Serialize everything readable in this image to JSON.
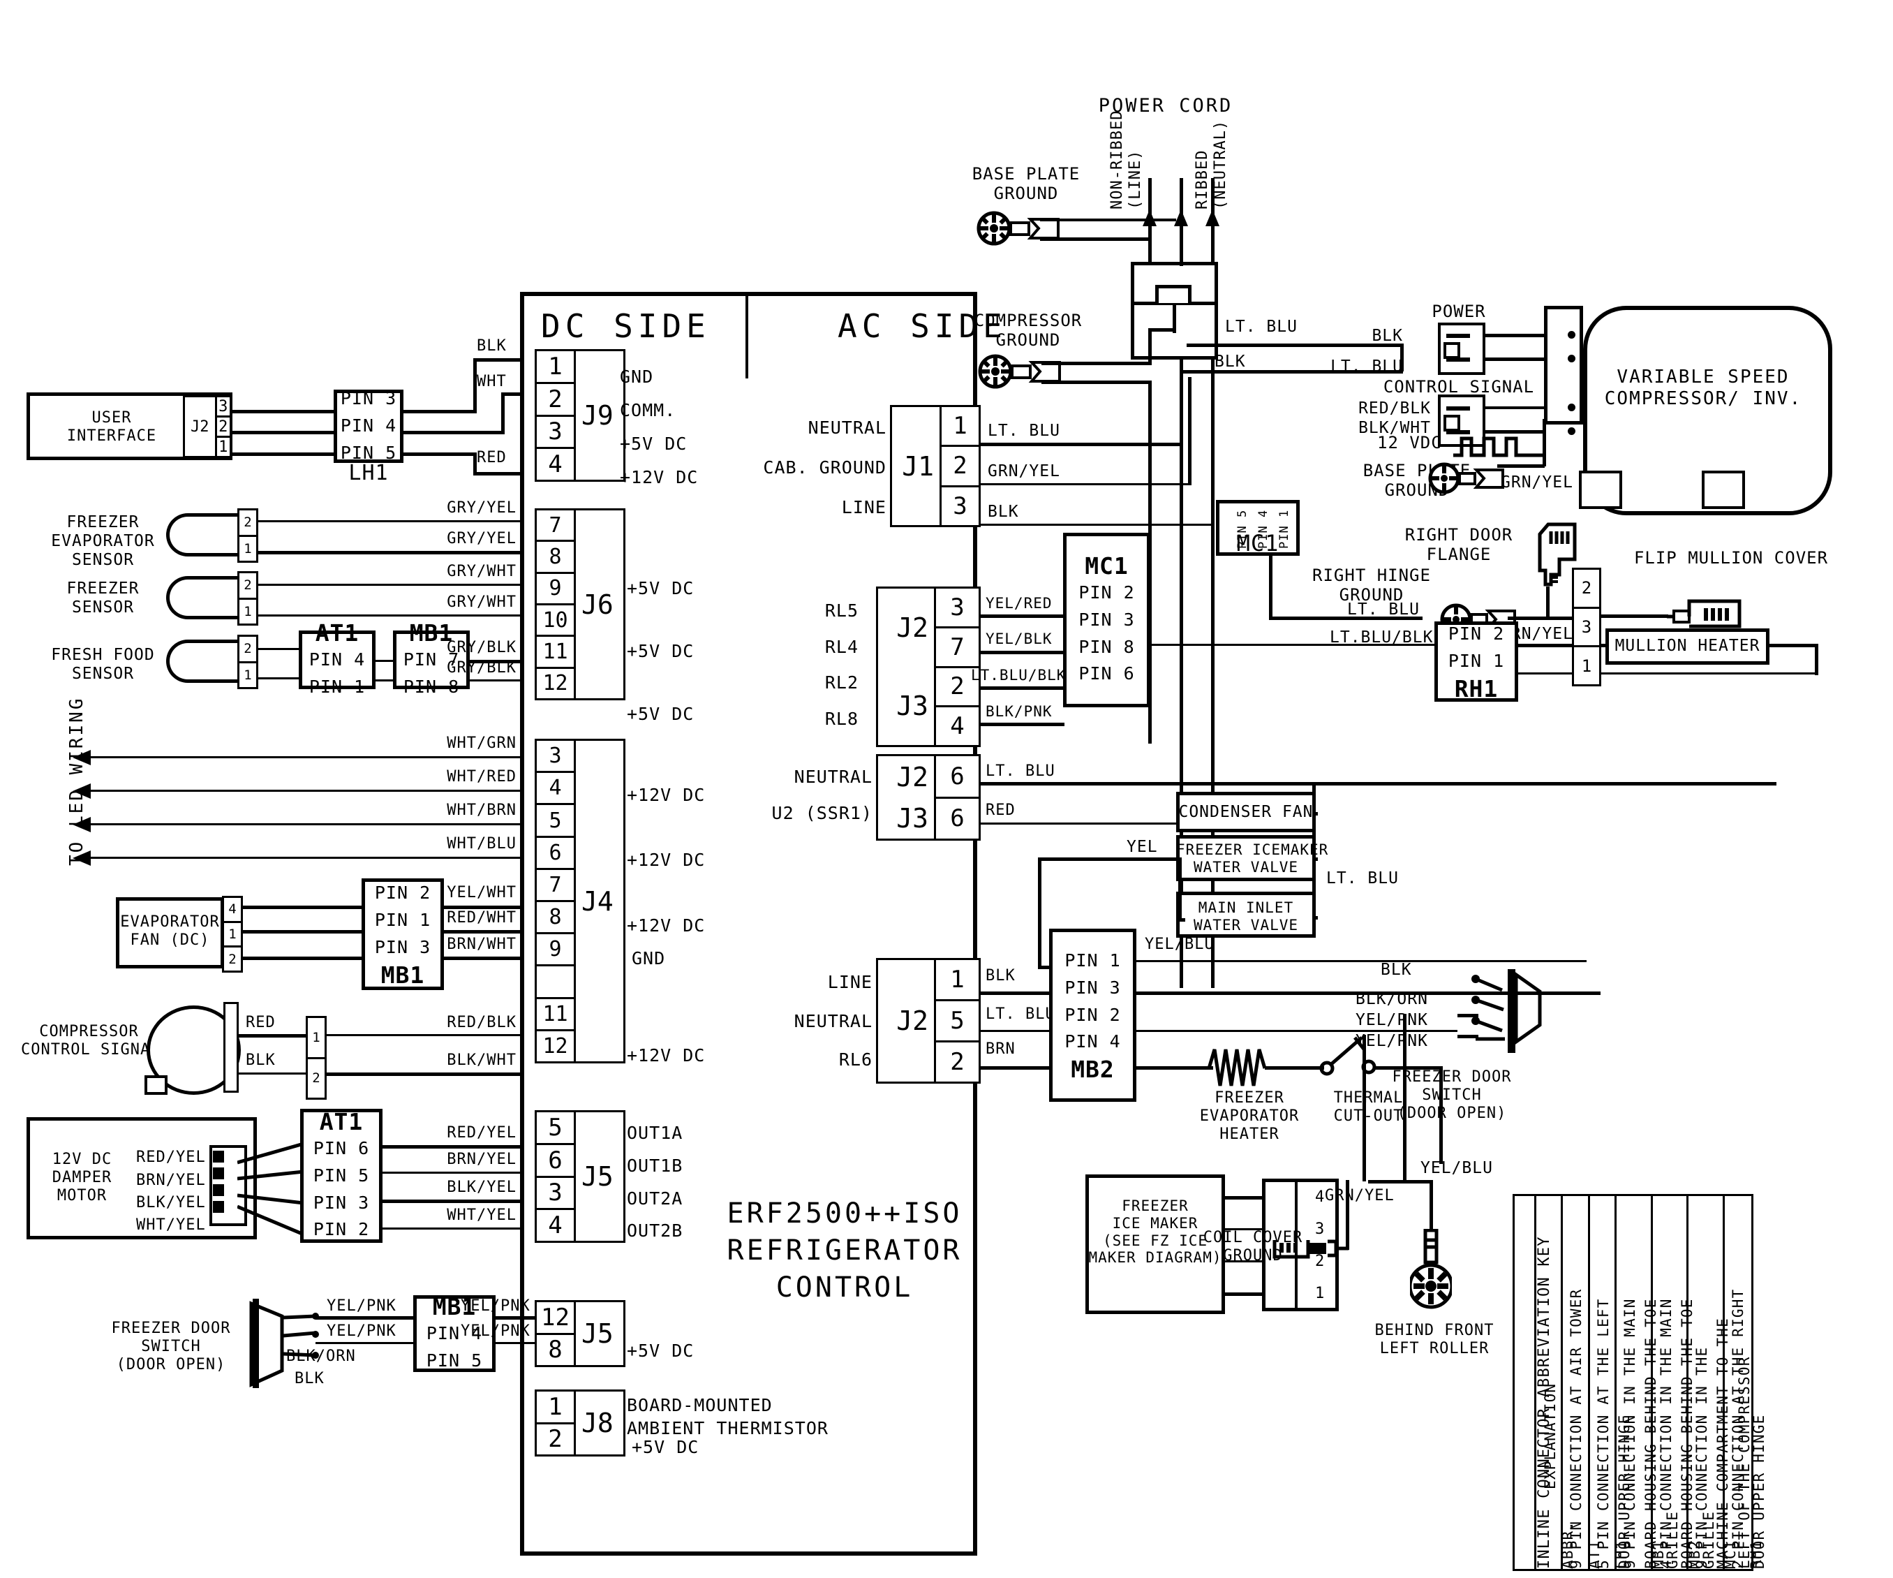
{
  "board": {
    "dc_side": "DC SIDE",
    "ac_side": "AC SIDE",
    "title_line1": "ERF2500++ISO",
    "title_line2": "REFRIGERATOR",
    "title_line3": "CONTROL"
  },
  "connectors": {
    "j9": {
      "name": "J9",
      "pins": [
        "1",
        "2",
        "3",
        "4"
      ],
      "functions": [
        "GND",
        "COMM.",
        "+5V DC",
        "+12V DC"
      ]
    },
    "j6": {
      "name": "J6",
      "pins": [
        "7",
        "8",
        "9",
        "10",
        "11",
        "12"
      ],
      "functions": [
        "+5V DC",
        "+5V DC",
        "+5V DC"
      ]
    },
    "j4": {
      "name": "J4",
      "pins": [
        "3",
        "4",
        "5",
        "6",
        "7",
        "8",
        "9",
        "",
        "11",
        "12"
      ],
      "functions": [
        "+12V DC",
        "+12V DC",
        "+12V DC",
        "GND",
        "+12V DC"
      ]
    },
    "j5a": {
      "name": "J5",
      "pins": [
        "5",
        "6",
        "3",
        "4"
      ],
      "functions": [
        "OUT1A",
        "OUT1B",
        "OUT2A",
        "OUT2B"
      ]
    },
    "j5b": {
      "name": "J5",
      "pins": [
        "12",
        "8"
      ],
      "functions": [
        "+5V DC"
      ]
    },
    "j8": {
      "name": "J8",
      "pins": [
        "1",
        "2"
      ],
      "functions": [
        "BOARD-MOUNTED\nAMBIENT THERMISTOR",
        "+5V DC"
      ]
    },
    "j1": {
      "name": "J1",
      "pins": [
        "1",
        "2",
        "3"
      ],
      "labels": [
        "NEUTRAL",
        "CAB. GROUND",
        "LINE"
      ],
      "wires": [
        "LT. BLU",
        "GRN/YEL",
        "BLK"
      ]
    },
    "relays_top": {
      "labels": [
        "RL5",
        "RL4",
        "RL2",
        "RL8"
      ],
      "names": [
        "J2",
        "J3"
      ],
      "pins": [
        "3",
        "7",
        "2",
        "4"
      ],
      "wires": [
        "YEL/RED",
        "YEL/BLK",
        "LT.BLU/BLK",
        "BLK/PNK"
      ]
    },
    "relays_mid": {
      "labels": [
        "NEUTRAL",
        "U2 (SSR1)"
      ],
      "names": [
        "J2",
        "J3"
      ],
      "pins": [
        "6",
        "6"
      ],
      "wires": [
        "LT. BLU",
        "RED"
      ]
    },
    "relays_low": {
      "labels": [
        "LINE",
        "NEUTRAL",
        "RL6"
      ],
      "names": [
        "J2"
      ],
      "pins": [
        "1",
        "5",
        "2"
      ],
      "wires": [
        "BLK",
        "LT. BLU",
        "BRN"
      ]
    }
  },
  "left_components": {
    "user_interface": "USER\nINTERFACE",
    "ui_conn_name": "J2",
    "ui_conn_pins": [
      "3",
      "2",
      "1"
    ],
    "lh1": {
      "name": "LH1",
      "pins": [
        "PIN 3",
        "PIN 4",
        "PIN 5"
      ]
    },
    "ui_wires": [
      "BLK",
      "WHT",
      "RED"
    ],
    "freezer_evap_sensor": "FREEZER\nEVAPORATOR\nSENSOR",
    "freezer_sensor": "FREEZER\nSENSOR",
    "fresh_food_sensor": "FRESH FOOD\nSENSOR",
    "sensor_wires": [
      "GRY/YEL",
      "GRY/YEL",
      "GRY/WHT",
      "GRY/WHT",
      "GRY/BLK",
      "GRY/BLK"
    ],
    "at1_sensor": {
      "name": "AT1",
      "pins": [
        "PIN 4",
        "PIN 1"
      ]
    },
    "mb1_sensor": {
      "name": "MB1",
      "pins": [
        "PIN 7",
        "PIN 8"
      ]
    },
    "to_led_wiring": "TO LED WIRING",
    "led_wires": [
      "WHT/GRN",
      "WHT/RED",
      "WHT/BRN",
      "WHT/BLU"
    ],
    "evaporator_fan": "EVAPORATOR\nFAN (DC)",
    "evap_fan_pins": [
      "4",
      "1",
      "2"
    ],
    "mb1_fan": {
      "name": "MB1",
      "pins": [
        "PIN 2",
        "PIN 1",
        "PIN 3"
      ]
    },
    "fan_wires": [
      "YEL/WHT",
      "RED/WHT",
      "BRN/WHT"
    ],
    "compressor_control_signal": "COMPRESSOR\nCONTROL SIGNAL",
    "ccs_wires_in": [
      "RED",
      "BLK"
    ],
    "ccs_conn_pins": [
      "1",
      "2"
    ],
    "ccs_wires_out": [
      "RED/BLK",
      "BLK/WHT"
    ],
    "damper_motor": "12V DC\nDAMPER\nMOTOR",
    "damper_wires": [
      "RED/YEL",
      "BRN/YEL",
      "BLK/YEL",
      "WHT/YEL"
    ],
    "at1_damper": {
      "name": "AT1",
      "pins": [
        "PIN 6",
        "PIN 5",
        "PIN 3",
        "PIN 2"
      ]
    },
    "damper_out_wires": [
      "RED/YEL",
      "BRN/YEL",
      "BLK/YEL",
      "WHT/YEL"
    ],
    "freezer_door_switch": "FREEZER DOOR\nSWITCH\n(DOOR OPEN)",
    "fds_wires": [
      "YEL/PNK",
      "YEL/PNK",
      "BLK/ORN",
      "BLK"
    ],
    "mb1_door": {
      "name": "MB1",
      "pins": [
        "PIN 4",
        "PIN 5"
      ]
    },
    "fds_out_wires": [
      "YEL/PNK",
      "YEL/PNK"
    ]
  },
  "right_components": {
    "power_cord": "POWER CORD",
    "non_ribbed": "NON-RIBBED\n(LINE)",
    "ribbed": "RIBBED\n(NEUTRAL)",
    "base_plate_ground_top": "BASE PLATE\nGROUND",
    "compressor_ground": "COMPRESSOR\nGROUND",
    "wire_ltblu_1": "LT. BLU",
    "wire_blk_1": "BLK",
    "wire_blk_power": "BLK",
    "wire_ltblu_power": "LT. BLU",
    "power_label": "POWER",
    "control_signal_label": "CONTROL SIGNAL",
    "control_signal_wires": [
      "RED/BLK",
      "BLK/WHT"
    ],
    "vdc_label": "12 VDC",
    "base_plate_ground_comp": "BASE PLATE\nGROUND",
    "grn_yel_comp": "GRN/YEL",
    "compressor": "VARIABLE SPEED\nCOMPRESSOR/ INV.",
    "mc1_top": {
      "name": "MC1",
      "pins": [
        "PIN 5",
        "PIN 4",
        "PIN 1"
      ]
    },
    "right_door_flange": "RIGHT DOOR\nFLANGE",
    "right_hinge_ground": "RIGHT HINGE\nGROUND",
    "grn_yel_hinge": "GRN/YEL",
    "flip_mullion_cover": "FLIP MULLION COVER",
    "mullion_heater": "MULLION HEATER",
    "rh1": {
      "name": "RH1",
      "pins": [
        "PIN 2",
        "PIN 1"
      ]
    },
    "rh1_wires": [
      "LT. BLU",
      "LT.BLU/BLK"
    ],
    "mullion_conn_pins": [
      "2",
      "3",
      "1"
    ],
    "mc1_relay": {
      "name": "MC1",
      "pins": [
        "PIN 2",
        "PIN 3",
        "PIN 8",
        "PIN 6"
      ]
    },
    "condenser_fan": "CONDENSER FAN",
    "freezer_icemaker_water_valve": "FREEZER ICEMAKER\nWATER VALVE",
    "main_inlet_water_valve": "MAIN INLET\nWATER VALVE",
    "wire_yel_valve": "YEL",
    "wire_ltblu_valve": "LT. BLU",
    "mb2": {
      "name": "MB2",
      "pins": [
        "PIN 1",
        "PIN 3",
        "PIN 2",
        "PIN 4"
      ]
    },
    "mb2_in_wires": [
      "YEL",
      "BLK",
      "LT. BLU",
      "BRN"
    ],
    "mb2_out_wires": [
      "YEL/BLU"
    ],
    "freezer_evaporator_heater": "FREEZER\nEVAPORATOR\nHEATER",
    "thermal_cut_out": "THERMAL\nCUT-OUT",
    "freezer_ice_maker": "FREEZER\nICE MAKER\n(SEE FZ ICE\nMAKER DIAGRAM)",
    "icemaker_conn_pins": [
      "4",
      "3",
      "2",
      "1"
    ],
    "coil_cover_ground": "COIL COVER\nGROUND",
    "behind_front_left_roller": "BEHIND FRONT\nLEFT ROLLER",
    "grn_yel_roller": "GRN/YEL",
    "fds_right": "FREEZER DOOR\nSWITCH\n(DOOR OPEN)",
    "fds_right_wires": [
      "BLK",
      "BLK/ORN",
      "YEL/PNK",
      "YEL/PNK"
    ],
    "yel_blu_bottom": "YEL/BLU"
  },
  "abbrev_table": {
    "title": "INLINE CONNECTOR ABBREVIATION KEY",
    "header_abbr": "ABBR.",
    "header_explanation": "EXPLANATION",
    "rows": [
      {
        "abbr": "AT1",
        "explanation": "9 PIN CONNECTION AT AIR TOWER"
      },
      {
        "abbr": "LH1",
        "explanation": "5 PIN CONNECTION AT THE LEFT\nDOOR UPPER HINGE"
      },
      {
        "abbr": "MB1",
        "explanation": "9 PIN CONNECTION IN THE MAIN\nBOARD HOUSING BEHIND THE TOE\nGRILLE"
      },
      {
        "abbr": "MB2",
        "explanation": "4 PIN CONNECTION IN THE MAIN\nBOARD HOUSING BEHIND THE TOE\nGRILLE"
      },
      {
        "abbr": "MC1",
        "explanation": "9 PIN CONNECTION IN THE\nMACHINE COMPARTMENT TO THE\nLEFT OF THE COMPRESSOR"
      },
      {
        "abbr": "RH1",
        "explanation": "2 PIN CONNECTION AT THE RIGHT\nDOOR UPPER HINGE"
      }
    ]
  },
  "colors": {
    "ink": "#000000",
    "paper": "#ffffff"
  }
}
